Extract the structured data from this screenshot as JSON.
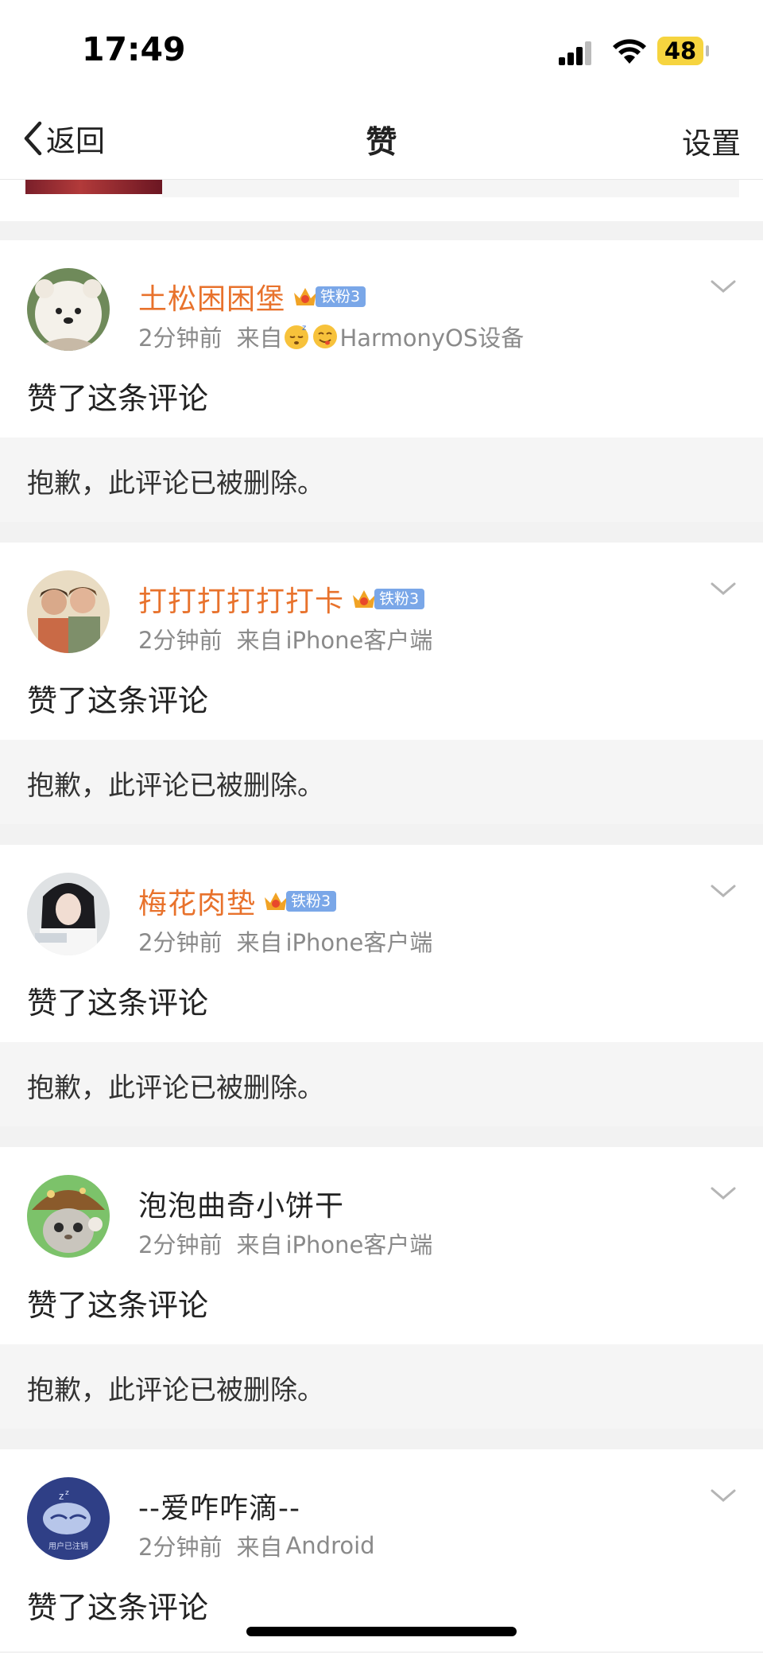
{
  "status_bar": {
    "time": "17:49",
    "battery": "48"
  },
  "nav": {
    "back_label": "返回",
    "title": "赞",
    "settings_label": "设置"
  },
  "feed": [
    {
      "username": "土松困困堡",
      "fan_badge": "铁粉3",
      "time": "2分钟前",
      "source_prefix": "来自",
      "source": "HarmonyOS设备",
      "action": "赞了这条评论",
      "quote": "抱歉，此评论已被删除。"
    },
    {
      "username": "打打打打打打卡",
      "fan_badge": "铁粉3",
      "time": "2分钟前",
      "source_prefix": "来自",
      "source": "iPhone客户端",
      "action": "赞了这条评论",
      "quote": "抱歉，此评论已被删除。"
    },
    {
      "username": "梅花肉垫",
      "fan_badge": "铁粉3",
      "time": "2分钟前",
      "source_prefix": "来自",
      "source": "iPhone客户端",
      "action": "赞了这条评论",
      "quote": "抱歉，此评论已被删除。"
    },
    {
      "username": "泡泡曲奇小饼干",
      "time": "2分钟前",
      "source_prefix": "来自",
      "source": "iPhone客户端",
      "action": "赞了这条评论",
      "quote": "抱歉，此评论已被删除。"
    },
    {
      "username": "--爱咋咋滴--",
      "avatar_text": "用户已注销",
      "time": "2分钟前",
      "source_prefix": "来自",
      "source": "Android",
      "action": "赞了这条评论"
    }
  ],
  "colors": {
    "username_highlight": "#e8722c",
    "fan_badge": "#7aa7e8",
    "battery": "#f6d43f"
  },
  "icons": [
    "signal-icon",
    "wifi-icon",
    "back-chevron-icon",
    "crown-icon",
    "sleepy-emoji-icon",
    "yum-emoji-icon",
    "chevron-down-icon"
  ]
}
